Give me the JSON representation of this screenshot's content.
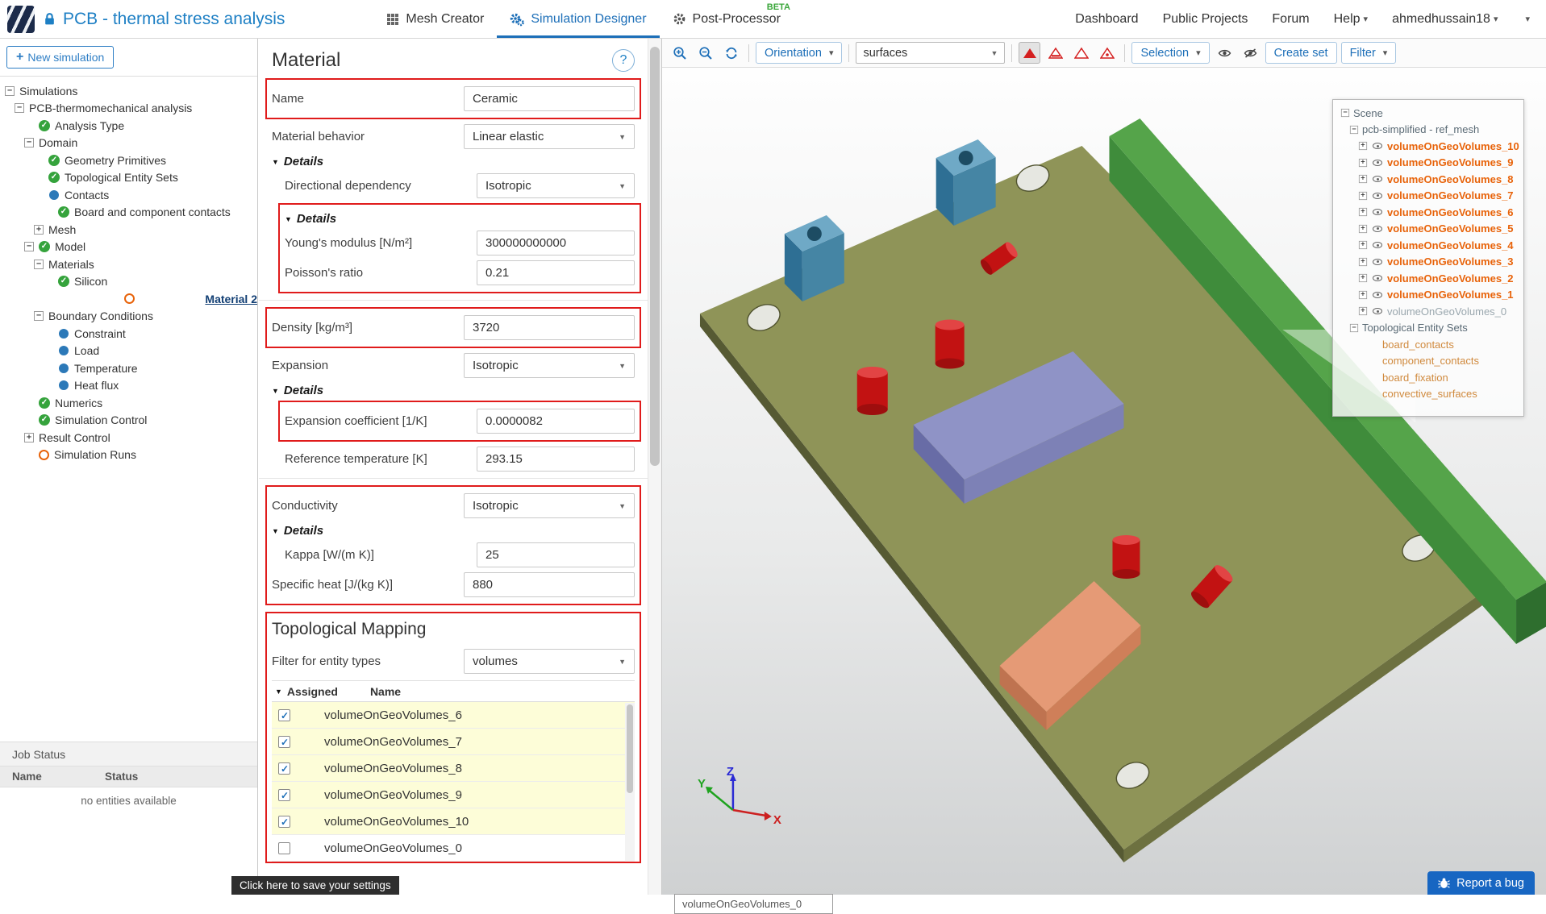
{
  "colors": {
    "brand_blue": "#1d7fc4",
    "active_tab_blue": "#1d6fb8",
    "highlight_orange": "#e8630a",
    "annotation_red": "#e01b1b",
    "beta_green": "#3aa63a",
    "row_highlight_yellow": "#fdfdd8",
    "report_bug_blue": "#1766c2",
    "pcb_olive": "#8f9458",
    "heatsink_green": "#55a44a",
    "component_blue": "#4585a4",
    "capacitor_red": "#c21212",
    "chip_purple": "#8f93c6",
    "component_orange": "#e59a76"
  },
  "navbar": {
    "title": "PCB - thermal stress analysis",
    "tabs": [
      {
        "label": "Mesh Creator"
      },
      {
        "label": "Simulation Designer"
      },
      {
        "label": "Post-Processor",
        "badge": "BETA"
      }
    ],
    "links": [
      "Dashboard",
      "Public Projects",
      "Forum"
    ],
    "help": "Help",
    "user": "ahmedhussain18"
  },
  "sidebar": {
    "new_simulation": "New simulation",
    "tree": [
      {
        "label": "Simulations",
        "level": 0,
        "expander": "minus",
        "status": null
      },
      {
        "label": "PCB-thermomechanical analysis",
        "level": 1,
        "expander": "minus",
        "status": null
      },
      {
        "label": "Analysis Type",
        "level": 2,
        "expander": null,
        "status": "check"
      },
      {
        "label": "Domain",
        "level": 2,
        "expander": "minus",
        "status": null
      },
      {
        "label": "Geometry Primitives",
        "level": 3,
        "expander": null,
        "status": "check"
      },
      {
        "label": "Topological Entity Sets",
        "level": 3,
        "expander": null,
        "status": "check"
      },
      {
        "label": "Contacts",
        "level": 3,
        "expander": null,
        "status": "dot"
      },
      {
        "label": "Board and component contacts",
        "level": 4,
        "expander": null,
        "status": "check"
      },
      {
        "label": "Mesh",
        "level": 3,
        "expander": "plus",
        "status": null
      },
      {
        "label": "Model",
        "level": 2,
        "expander": "minus",
        "status": "check"
      },
      {
        "label": "Materials",
        "level": 3,
        "expander": "minus",
        "status": null
      },
      {
        "label": "Silicon",
        "level": 4,
        "expander": null,
        "status": "check"
      },
      {
        "label": "Material 2",
        "level": 4,
        "expander": null,
        "status": "orange",
        "selected": true
      },
      {
        "label": "Boundary Conditions",
        "level": 3,
        "expander": "minus",
        "status": null
      },
      {
        "label": "Constraint",
        "level": 4,
        "expander": null,
        "status": "dot"
      },
      {
        "label": "Load",
        "level": 4,
        "expander": null,
        "status": "dot"
      },
      {
        "label": "Temperature",
        "level": 4,
        "expander": null,
        "status": "dot"
      },
      {
        "label": "Heat flux",
        "level": 4,
        "expander": null,
        "status": "dot"
      },
      {
        "label": "Numerics",
        "level": 2,
        "expander": null,
        "status": "check"
      },
      {
        "label": "Simulation Control",
        "level": 2,
        "expander": null,
        "status": "check"
      },
      {
        "label": "Result Control",
        "level": 2,
        "expander": "plus",
        "status": null
      },
      {
        "label": "Simulation Runs",
        "level": 2,
        "expander": null,
        "status": "orange"
      }
    ],
    "job_status": {
      "title": "Job Status",
      "columns": [
        "Name",
        "Status"
      ],
      "empty": "no entities available"
    },
    "tooltip": "Click here to save your settings"
  },
  "panel": {
    "title": "Material",
    "help_label": "?",
    "name_label": "Name",
    "name_value": "Ceramic",
    "behavior_label": "Material behavior",
    "behavior_value": "Linear elastic",
    "details_label": "Details",
    "directional_label": "Directional dependency",
    "directional_value": "Isotropic",
    "youngs_label": "Young's modulus [N/m²]",
    "youngs_value": "300000000000",
    "poisson_label": "Poisson's ratio",
    "poisson_value": "0.21",
    "density_label": "Density [kg/m³]",
    "density_value": "3720",
    "expansion_label": "Expansion",
    "expansion_value": "Isotropic",
    "exp_coeff_label": "Expansion coefficient [1/K]",
    "exp_coeff_value": "0.0000082",
    "ref_temp_label": "Reference temperature [K]",
    "ref_temp_value": "293.15",
    "conductivity_label": "Conductivity",
    "conductivity_value": "Isotropic",
    "kappa_label": "Kappa [W/(m K)]",
    "kappa_value": "25",
    "specific_label": "Specific heat [J/(kg K)]",
    "specific_value": "880",
    "topo": {
      "title": "Topological Mapping",
      "filter_label": "Filter for entity types",
      "filter_value": "volumes",
      "columns": [
        "Assigned",
        "Name"
      ],
      "rows": [
        {
          "name": "volumeOnGeoVolumes_6",
          "checked": true,
          "highlight": true
        },
        {
          "name": "volumeOnGeoVolumes_7",
          "checked": true,
          "highlight": true
        },
        {
          "name": "volumeOnGeoVolumes_8",
          "checked": true,
          "highlight": true
        },
        {
          "name": "volumeOnGeoVolumes_9",
          "checked": true,
          "highlight": true
        },
        {
          "name": "volumeOnGeoVolumes_10",
          "checked": true,
          "highlight": true
        },
        {
          "name": "volumeOnGeoVolumes_0",
          "checked": false,
          "highlight": false
        }
      ]
    }
  },
  "viewport": {
    "toolbar": {
      "orientation": "Orientation",
      "surfaces_value": "surfaces",
      "selection": "Selection",
      "create_set": "Create set",
      "filter": "Filter"
    },
    "scene_tree": [
      {
        "label": "Scene",
        "level": 0,
        "expander": "minus",
        "eye": false,
        "style": "plain"
      },
      {
        "label": "pcb-simplified - ref_mesh",
        "level": 1,
        "expander": "minus",
        "eye": false,
        "style": "plain"
      },
      {
        "label": "volumeOnGeoVolumes_10",
        "level": 2,
        "expander": "plus",
        "eye": true,
        "style": "orange"
      },
      {
        "label": "volumeOnGeoVolumes_9",
        "level": 2,
        "expander": "plus",
        "eye": true,
        "style": "orange"
      },
      {
        "label": "volumeOnGeoVolumes_8",
        "level": 2,
        "expander": "plus",
        "eye": true,
        "style": "orange"
      },
      {
        "label": "volumeOnGeoVolumes_7",
        "level": 2,
        "expander": "plus",
        "eye": true,
        "style": "orange"
      },
      {
        "label": "volumeOnGeoVolumes_6",
        "level": 2,
        "expander": "plus",
        "eye": true,
        "style": "orange"
      },
      {
        "label": "volumeOnGeoVolumes_5",
        "level": 2,
        "expander": "plus",
        "eye": true,
        "style": "orange"
      },
      {
        "label": "volumeOnGeoVolumes_4",
        "level": 2,
        "expander": "plus",
        "eye": true,
        "style": "orange"
      },
      {
        "label": "volumeOnGeoVolumes_3",
        "level": 2,
        "expander": "plus",
        "eye": true,
        "style": "orange"
      },
      {
        "label": "volumeOnGeoVolumes_2",
        "level": 2,
        "expander": "plus",
        "eye": true,
        "style": "orange"
      },
      {
        "label": "volumeOnGeoVolumes_1",
        "level": 2,
        "expander": "plus",
        "eye": true,
        "style": "orange"
      },
      {
        "label": "volumeOnGeoVolumes_0",
        "level": 2,
        "expander": "plus",
        "eye": true,
        "style": "muted"
      },
      {
        "label": "Topological Entity Sets",
        "level": 1,
        "expander": "minus",
        "eye": false,
        "style": "plain"
      },
      {
        "label": "board_contacts",
        "level": 2,
        "expander": null,
        "eye": false,
        "style": "set"
      },
      {
        "label": "component_contacts",
        "level": 2,
        "expander": null,
        "eye": false,
        "style": "set"
      },
      {
        "label": "board_fixation",
        "level": 2,
        "expander": null,
        "eye": false,
        "style": "set"
      },
      {
        "label": "convective_surfaces",
        "level": 2,
        "expander": null,
        "eye": false,
        "style": "set"
      }
    ],
    "selection_label": "volumeOnGeoVolumes_0",
    "report_bug": "Report a bug",
    "axes": {
      "x": "X",
      "y": "Y",
      "z": "Z"
    }
  }
}
